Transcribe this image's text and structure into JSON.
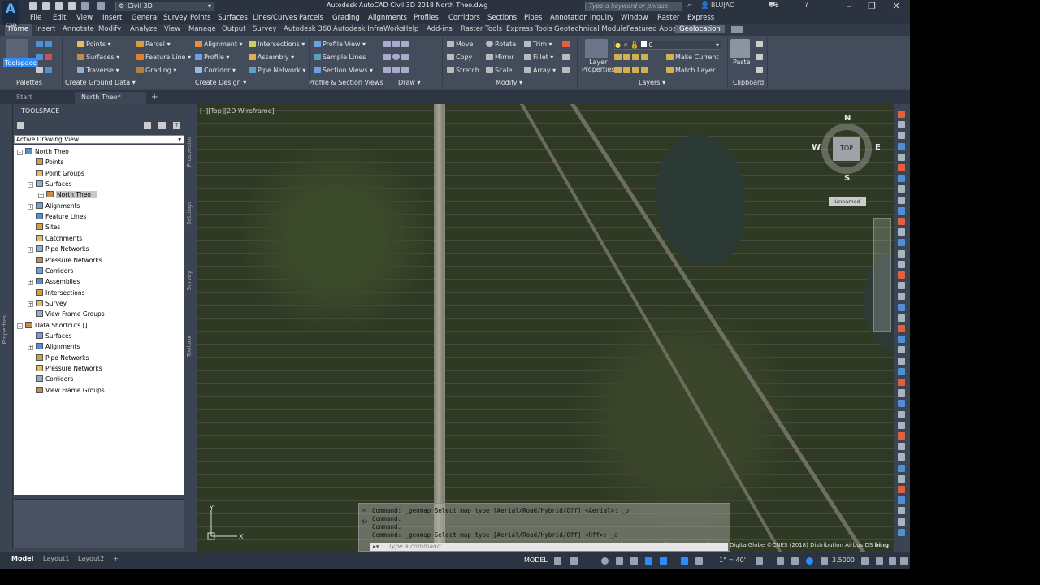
{
  "app": {
    "logo_letter": "A",
    "logo_sub": "C3D",
    "workspace": "Civil 3D",
    "window_title": "Autodesk AutoCAD Civil 3D 2018   North Theo.dwg",
    "search_placeholder": "Type a keyword or phrase",
    "user": "BLUJAC",
    "colors": {
      "accent": "#2d8cff",
      "ribbon_bg": "#434c5b",
      "titlebar_bg": "#2b3340",
      "selection": "#c7c7c7"
    }
  },
  "menu": [
    "File",
    "Edit",
    "View",
    "Insert",
    "General",
    "Survey",
    "Points",
    "Surfaces",
    "Lines/Curves",
    "Parcels",
    "Grading",
    "Alignments",
    "Profiles",
    "Corridors",
    "Sections",
    "Pipes",
    "Annotation",
    "Inquiry",
    "Window",
    "Raster",
    "Express"
  ],
  "ribbon_tabs": [
    "Home",
    "Insert",
    "Annotate",
    "Modify",
    "Analyze",
    "View",
    "Manage",
    "Output",
    "Survey",
    "Autodesk 360",
    "Autodesk InfraWorks",
    "Help",
    "Add-ins",
    "Raster Tools",
    "Express Tools",
    "Geotechnical Module",
    "Featured Apps",
    "Geolocation"
  ],
  "ribbon": {
    "palettes": {
      "toolspace": "Toolspace",
      "label": "Palettes"
    },
    "ground": {
      "points": "Points",
      "surfaces": "Surfaces",
      "traverse": "Traverse",
      "label": "Create Ground Data"
    },
    "design": {
      "parcel": "Parcel",
      "feature_line": "Feature Line",
      "grading": "Grading",
      "alignment": "Alignment",
      "profile": "Profile",
      "corridor": "Corridor",
      "intersections": "Intersections",
      "assembly": "Assembly",
      "pipe_network": "Pipe Network",
      "label": "Create Design"
    },
    "profile_section": {
      "profile_view": "Profile View",
      "sample_lines": "Sample Lines",
      "section_views": "Section Views",
      "label": "Profile & Section Views"
    },
    "draw": {
      "label": "Draw"
    },
    "modify": {
      "move": "Move",
      "rotate": "Rotate",
      "trim": "Trim",
      "copy": "Copy",
      "mirror": "Mirror",
      "fillet": "Fillet",
      "stretch": "Stretch",
      "scale": "Scale",
      "array": "Array",
      "label": "Modify"
    },
    "layers": {
      "layer_properties": "Layer\nProperties",
      "layer_value": "0",
      "make_current": "Make Current",
      "match_layer": "Match Layer",
      "label": "Layers"
    },
    "clipboard": {
      "paste": "Paste",
      "label": "Clipboard"
    }
  },
  "doc_tabs": [
    "Start",
    "North Theo*"
  ],
  "toolspace": {
    "title": "TOOLSPACE",
    "view_select": "Active Drawing View",
    "side_tabs": [
      "Prospector",
      "Settings",
      "Survey",
      "Toolbox"
    ],
    "palette_strip_label": "Properties",
    "tree": [
      {
        "label": "North Theo",
        "level": 0,
        "expand": "-"
      },
      {
        "label": "Points",
        "level": 1,
        "expand": ""
      },
      {
        "label": "Point Groups",
        "level": 1,
        "expand": ""
      },
      {
        "label": "Surfaces",
        "level": 1,
        "expand": "-"
      },
      {
        "label": "North Theo",
        "level": 2,
        "expand": "+",
        "selected": true
      },
      {
        "label": "Alignments",
        "level": 1,
        "expand": "+"
      },
      {
        "label": "Feature Lines",
        "level": 1,
        "expand": ""
      },
      {
        "label": "Sites",
        "level": 1,
        "expand": ""
      },
      {
        "label": "Catchments",
        "level": 1,
        "expand": ""
      },
      {
        "label": "Pipe Networks",
        "level": 1,
        "expand": "+"
      },
      {
        "label": "Pressure Networks",
        "level": 1,
        "expand": ""
      },
      {
        "label": "Corridors",
        "level": 1,
        "expand": ""
      },
      {
        "label": "Assemblies",
        "level": 1,
        "expand": "+"
      },
      {
        "label": "Intersections",
        "level": 1,
        "expand": ""
      },
      {
        "label": "Survey",
        "level": 1,
        "expand": "+"
      },
      {
        "label": "View Frame Groups",
        "level": 1,
        "expand": ""
      },
      {
        "label": "Data Shortcuts []",
        "level": 0,
        "expand": "-"
      },
      {
        "label": "Surfaces",
        "level": 1,
        "expand": ""
      },
      {
        "label": "Alignments",
        "level": 1,
        "expand": "+"
      },
      {
        "label": "Pipe Networks",
        "level": 1,
        "expand": ""
      },
      {
        "label": "Pressure Networks",
        "level": 1,
        "expand": ""
      },
      {
        "label": "Corridors",
        "level": 1,
        "expand": ""
      },
      {
        "label": "View Frame Groups",
        "level": 1,
        "expand": ""
      }
    ]
  },
  "viewport": {
    "label": "[–][Top][2D Wireframe]",
    "viewcube": {
      "face": "TOP",
      "n": "N",
      "s": "S",
      "e": "E",
      "w": "W",
      "ucs_label": "Unnamed"
    },
    "ucs": {
      "x": "X",
      "y": "Y"
    },
    "copyright": "© 2018 Microsoft Corporation © 2018 DigitalGlobe ©CNES (2018) Distribution Airbus DS",
    "bing": "bing"
  },
  "command": {
    "history": [
      "Command: _geomap Select map type [Aerial/Road/Hybrid/Off] <Aerial>: _o",
      "Command:",
      "Command:",
      "Command: _geomap Select map type [Aerial/Road/Hybrid/Off] <Off>: _a"
    ],
    "placeholder": "Type a command"
  },
  "status": {
    "layouts": [
      "Model",
      "Layout1",
      "Layout2"
    ],
    "model": "MODEL",
    "scale": "1\" = 40'",
    "value": "3.5000"
  }
}
